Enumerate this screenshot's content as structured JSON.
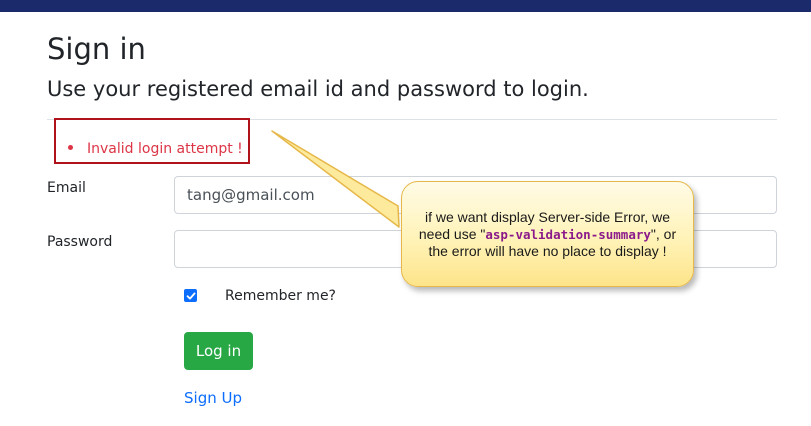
{
  "header": {
    "title": "Sign in",
    "subtitle": "Use your registered email id and password to login."
  },
  "validation_summary": {
    "errors": [
      "Invalid login attempt !"
    ]
  },
  "form": {
    "email_label": "Email",
    "email_value": "tang@gmail.com",
    "password_label": "Password",
    "password_value": "",
    "remember_label": "Remember me?",
    "remember_checked": true,
    "login_label": "Log in",
    "signup_label": "Sign Up"
  },
  "annotation": {
    "text_before": "if we want display Server-side Error, we need use \"",
    "code": "asp-validation-summary",
    "text_after": "\", or the error will have no place to display !"
  },
  "colors": {
    "topbar": "#1b2a6b",
    "error": "#dc3545",
    "error_box_border": "#b0121b",
    "login_button": "#28a745",
    "link": "#0d6efd",
    "callout_fill": "#fff3b8",
    "callout_border": "#e6b84a",
    "code_text": "#8b1a8b"
  },
  "icons": {
    "checkbox": "check-icon",
    "error_bullet": "bullet-icon"
  }
}
